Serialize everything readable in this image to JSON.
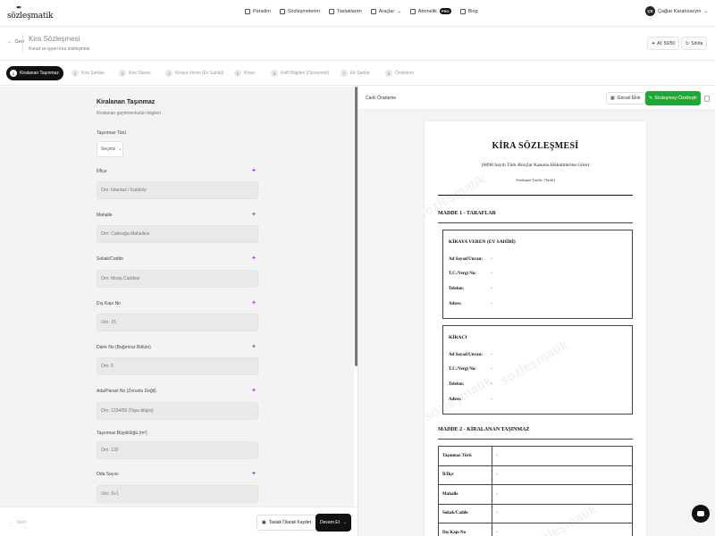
{
  "brand": {
    "logo_mark": "✒",
    "logo_text": "sözleşmatik"
  },
  "nav": {
    "items": [
      {
        "label": "Panelim",
        "icon": "home-icon"
      },
      {
        "label": "Sözleşmelerim",
        "icon": "document-icon"
      },
      {
        "label": "Taslaklarım",
        "icon": "folder-icon"
      },
      {
        "label": "Araçlar",
        "icon": "wrench-icon"
      },
      {
        "label": "Abonelik",
        "icon": "wallet-icon"
      },
      {
        "label": "Blog",
        "icon": "book-icon"
      }
    ],
    "pro_badge": "PRO",
    "user_initials": "ÇK",
    "user_name": "Çağlar Karahüseyin"
  },
  "header": {
    "back_label": "Geri",
    "title": "Kira Sözleşmesi",
    "subtitle": "Konut ve işyeri kira sözleşmesi",
    "ai_credit": "AI: 50/50",
    "ai_credit_icon": "sparkle-icon",
    "reset_label": "Sıfırla"
  },
  "steps": [
    {
      "num": "1",
      "label": "Kiralanan Taşınmaz",
      "active": true
    },
    {
      "num": "2",
      "label": "Kira Şartları",
      "active": false
    },
    {
      "num": "3",
      "label": "Kira Süresi",
      "active": false
    },
    {
      "num": "4",
      "label": "Kiraya Veren (Ev Sahibi)",
      "active": false
    },
    {
      "num": "5",
      "label": "Kiracı",
      "active": false
    },
    {
      "num": "6",
      "label": "Kefil Bilgileri (Opsiyonel)",
      "active": false
    },
    {
      "num": "7",
      "label": "Ek Şartlar",
      "active": false
    },
    {
      "num": "8",
      "label": "Önizleme",
      "active": false
    }
  ],
  "form": {
    "title": "Kiralanan Taşınmaz",
    "subtitle": "Kiralanan gayrimenkulün bilgileri",
    "property_type": {
      "label": "Taşınmaz Türü",
      "value": "Seçiniz"
    },
    "fields": [
      {
        "label": "İl/İlçe",
        "placeholder": "Örn: İstanbul / Kadıköy",
        "ai": true
      },
      {
        "label": "Mahalle",
        "placeholder": "Örn: Caferağa Mahallesi",
        "ai": true
      },
      {
        "label": "Sokak/Cadde",
        "placeholder": "Örn: Moda Caddesi",
        "ai": true
      },
      {
        "label": "Dış Kapı No",
        "placeholder": "Örn: 15",
        "ai": true
      },
      {
        "label": "Daire No (Bağımsız Bölüm)",
        "placeholder": "Örn: 5",
        "ai": true
      },
      {
        "label": "Ada/Parsel No (Zorunlu Değil)",
        "placeholder": "Örn: 1234/56 (Tapu bilgisi)",
        "ai": true
      },
      {
        "label": "Taşınmaz Büyüklüğü (m²)",
        "placeholder": "Örn: 120",
        "ai": false
      },
      {
        "label": "Oda Sayısı",
        "placeholder": "Örn: 3+1",
        "ai": true
      }
    ]
  },
  "footer": {
    "back_label": "Geri",
    "draft_label": "Taslak Olarak Kaydet",
    "continue_label": "Devam Et"
  },
  "preview": {
    "title": "Canlı Önizleme",
    "visual_label": "Görsel Ekle",
    "customize_label": "Sözleşmeyi Özelleştir",
    "watermark": "sözleşmatik",
    "doc": {
      "title": "KİRA SÖZLEŞMESİ",
      "law": "(6098 Sayılı Türk Borçlar Kanunu Hükümlerine Göre)",
      "date": "Sözleşme Tarihi: [Tarih]",
      "article1": "MADDE 1 - TARAFLAR",
      "landlord": {
        "title": "KİRAYA VEREN (EV SAHİBİ)",
        "rows": [
          {
            "k": "Ad Soyad/Unvan:",
            "v": "-"
          },
          {
            "k": "T.C./Vergi No:",
            "v": "-"
          },
          {
            "k": "Telefon:",
            "v": "-"
          },
          {
            "k": "Adres:",
            "v": "-"
          }
        ]
      },
      "tenant": {
        "title": "KİRACI",
        "rows": [
          {
            "k": "Ad Soyad/Unvan:",
            "v": "-"
          },
          {
            "k": "T.C./Vergi No:",
            "v": "-"
          },
          {
            "k": "Telefon:",
            "v": "-"
          },
          {
            "k": "Adres:",
            "v": "-"
          }
        ]
      },
      "article2": "MADDE 2 - KİRALANAN TAŞINMAZ",
      "property_rows": [
        {
          "k": "Taşınmaz Türü",
          "v": "-"
        },
        {
          "k": "İl/İlçe",
          "v": "-"
        },
        {
          "k": "Mahalle",
          "v": "-"
        },
        {
          "k": "Sokak/Cadde",
          "v": "-"
        },
        {
          "k": "Dış Kapı No",
          "v": "-"
        }
      ]
    }
  },
  "colors": {
    "accent_green": "#1fa835",
    "ai_purple": "#b044d8",
    "primary_dark": "#111111"
  }
}
